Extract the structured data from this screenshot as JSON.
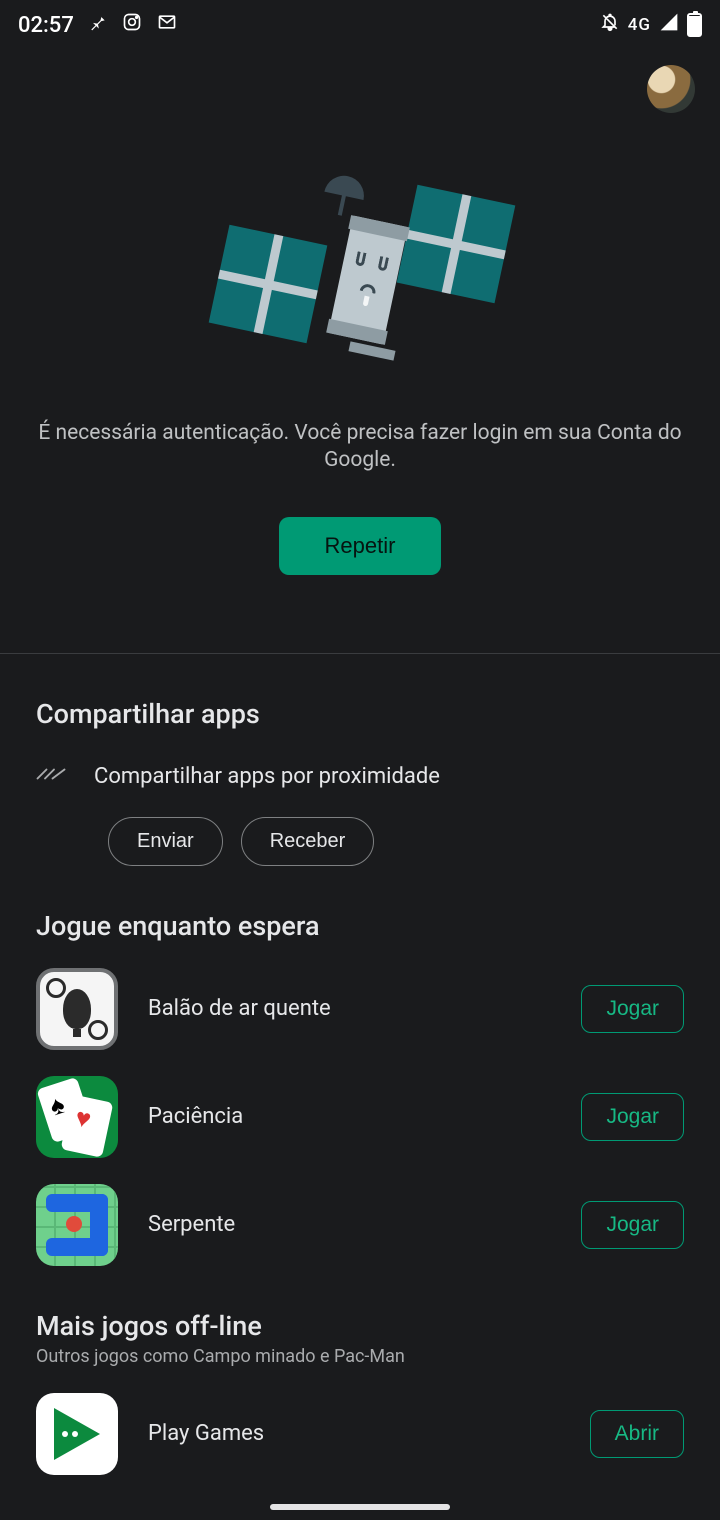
{
  "status": {
    "time": "02:57",
    "network": "4G",
    "battery_pct": "97"
  },
  "error": {
    "message": "É necessária autenticação. Você precisa fazer login em sua Conta do Google.",
    "retry": "Repetir"
  },
  "share": {
    "title": "Compartilhar apps",
    "subtitle": "Compartilhar apps por proximidade",
    "send": "Enviar",
    "receive": "Receber"
  },
  "play_wait": {
    "title": "Jogue enquanto espera",
    "play_label": "Jogar",
    "games": [
      {
        "name": "Balão de ar quente"
      },
      {
        "name": "Paciência"
      },
      {
        "name": "Serpente"
      }
    ]
  },
  "offline": {
    "title": "Mais jogos off-line",
    "subtitle": "Outros jogos como Campo minado e Pac-Man",
    "open_label": "Abrir",
    "app": "Play Games"
  }
}
